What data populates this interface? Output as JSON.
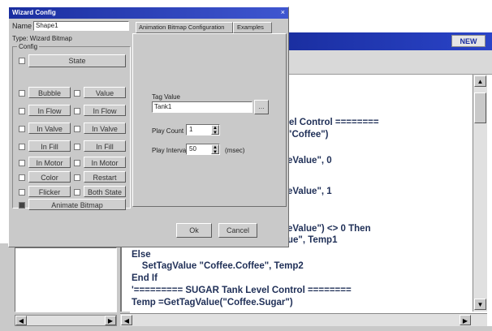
{
  "editor": {
    "window_controls": "NEW",
    "code_lines": [
      "el Control ========",
      "\"Coffee\")",
      "eValue\", 0",
      "eValue\", 1",
      "eValue\") <> 0 Then",
      "ue\", Temp1",
      "Else",
      "    SetTagValue \"Coffee.Coffee\", Temp2",
      "End If",
      "'========= SUGAR Tank Level Control ========",
      "Temp =GetTagValue(\"Coffee.Sugar\")"
    ]
  },
  "dialog": {
    "title": "Wizard Config",
    "name_label": "Name",
    "name_value": "Shape1",
    "type_label": "Type: Wizard Bitmap",
    "config_label": "Config",
    "state_label": "State",
    "tabs": [
      "Animation Bitmap Configuration",
      "Examples"
    ],
    "buttons_left": [
      "Bubble",
      "In Flow",
      "In Valve",
      "In Fill",
      "In Motor",
      "Color",
      "Flicker"
    ],
    "buttons_right": [
      "Value",
      "In Flow",
      "In Valve",
      "In Fill",
      "In Motor",
      "Restart",
      "Both State"
    ],
    "extra_button": "Animate Bitmap",
    "tag_value_label": "Tag Value",
    "tag_value": "Tank1",
    "play_count_label": "Play Count",
    "play_count": "1",
    "play_interval_label": "Play Interval",
    "play_interval": "50",
    "play_interval_unit": "(msec)",
    "ok_label": "Ok",
    "cancel_label": "Cancel"
  },
  "colors": {
    "titlebar": "#1a2ea0",
    "chrome": "#c9c9c9",
    "code_text": "#1f2f57"
  },
  "icons": [
    "scroll-up-arrow-icon",
    "scroll-down-arrow-icon",
    "scroll-left-arrow-icon",
    "scroll-right-arrow-icon",
    "tag-browse-icon"
  ]
}
